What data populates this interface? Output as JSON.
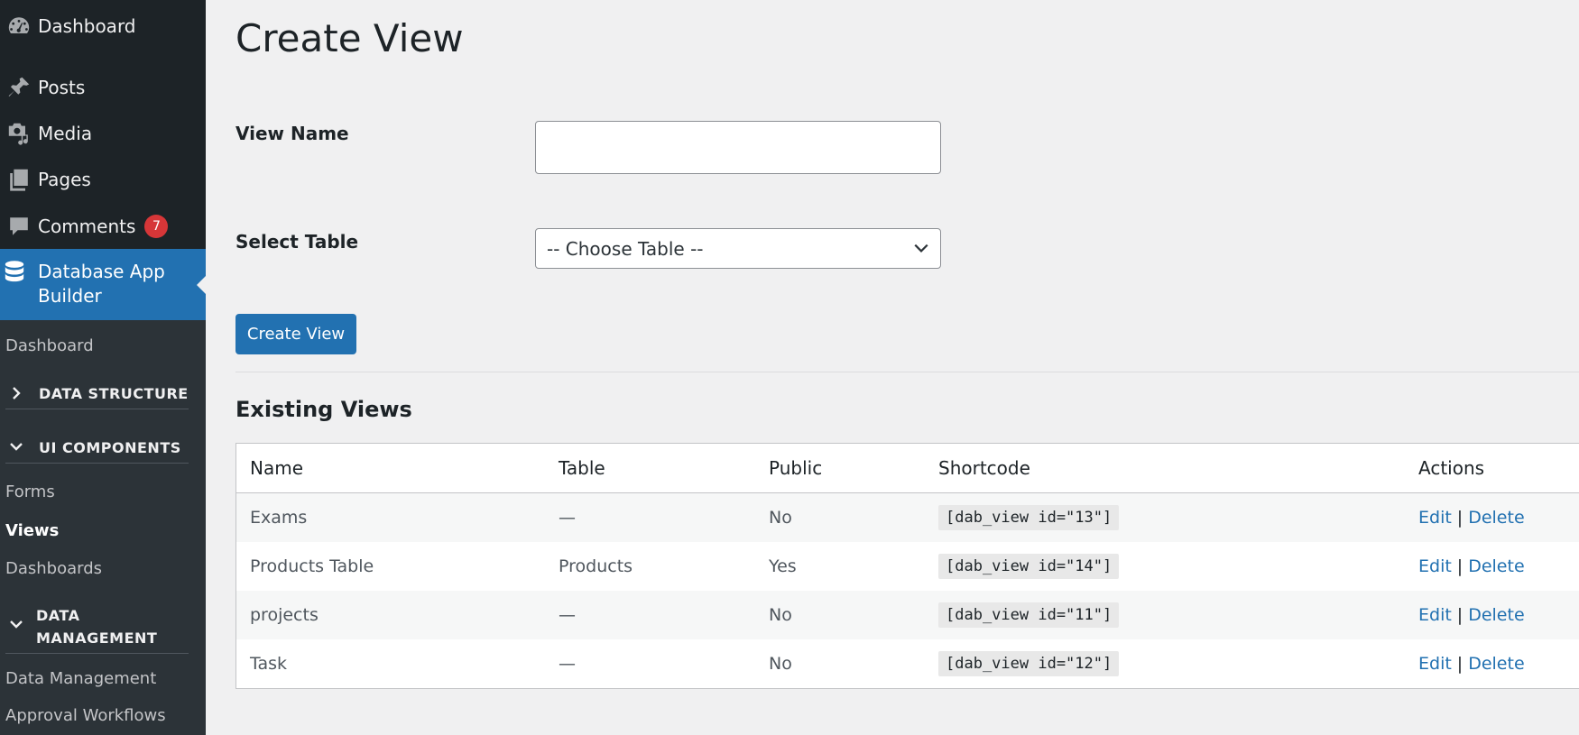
{
  "sidebar": {
    "items": [
      {
        "label": "Dashboard",
        "icon": "dashboard-icon"
      },
      {
        "label": "Posts",
        "icon": "pin-icon"
      },
      {
        "label": "Media",
        "icon": "media-icon"
      },
      {
        "label": "Pages",
        "icon": "pages-icon"
      },
      {
        "label": "Comments",
        "icon": "comment-icon",
        "badge": "7"
      }
    ],
    "active": {
      "label": "Database App Builder",
      "icon": "database-icon"
    },
    "submenu": {
      "dashboard": "Dashboard",
      "data_structure": "DATA STRUCTURE",
      "ui_components": "UI COMPONENTS",
      "forms": "Forms",
      "views": "Views",
      "dashboards": "Dashboards",
      "data_management_head": "DATA MANAGEMENT",
      "data_management": "Data Management",
      "approval_workflows": "Approval Workflows"
    }
  },
  "main": {
    "title": "Create View",
    "view_name_label": "View Name",
    "view_name_value": "",
    "select_table_label": "Select Table",
    "select_table_value": "-- Choose Table --",
    "create_button": "Create View",
    "existing_title": "Existing Views",
    "table": {
      "headers": {
        "name": "Name",
        "table": "Table",
        "public": "Public",
        "shortcode": "Shortcode",
        "actions": "Actions"
      },
      "rows": [
        {
          "name": "Exams",
          "table": "—",
          "public": "No",
          "shortcode": "[dab_view id=\"13\"]",
          "edit": "Edit",
          "sep": "|",
          "delete": "Delete"
        },
        {
          "name": "Products Table",
          "table": "Products",
          "public": "Yes",
          "shortcode": "[dab_view id=\"14\"]",
          "edit": "Edit",
          "sep": "|",
          "delete": "Delete"
        },
        {
          "name": "projects",
          "table": "—",
          "public": "No",
          "shortcode": "[dab_view id=\"11\"]",
          "edit": "Edit",
          "sep": "|",
          "delete": "Delete"
        },
        {
          "name": "Task",
          "table": "—",
          "public": "No",
          "shortcode": "[dab_view id=\"12\"]",
          "edit": "Edit",
          "sep": "|",
          "delete": "Delete"
        }
      ]
    }
  },
  "colors": {
    "sidebar_bg": "#1d2327",
    "submenu_bg": "#2c3338",
    "accent": "#2271b1",
    "badge": "#d63638",
    "page_bg": "#f0f0f1"
  }
}
